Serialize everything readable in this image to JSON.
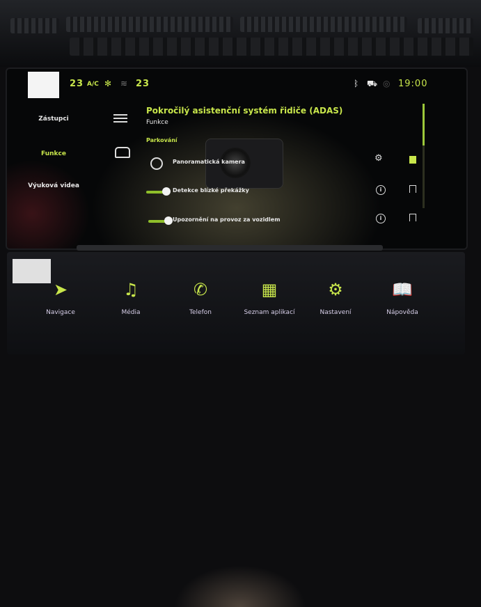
{
  "status_bar": {
    "temp_left": "23",
    "ac_label": "A/C",
    "temp_right": "23",
    "time": "19:00",
    "icons": [
      "fan-icon",
      "seat-heat-icon",
      "bluetooth-icon",
      "car-connect-icon",
      "signal-icon"
    ]
  },
  "sidebar": {
    "items": [
      {
        "label": "Zástupci",
        "active": false
      },
      {
        "label": "Funkce",
        "active": true
      },
      {
        "label": "Výuková videa",
        "active": false
      }
    ]
  },
  "main": {
    "title": "Pokročilý asistenční systém řidiče (ADAS)",
    "subtitle": "Funkce",
    "section": "Parkování",
    "rows": [
      {
        "label": "Panoramatická kamera",
        "type": "icon",
        "icon": "camera-360-icon",
        "action": "gear-icon",
        "bookmarked": true
      },
      {
        "label": "Detekce blízké překážky",
        "type": "toggle",
        "on": true,
        "action": "info-icon",
        "bookmarked": false
      },
      {
        "label": "Upozornění na provoz za vozidlem",
        "type": "toggle",
        "on": true,
        "action": "info-icon",
        "bookmarked": false
      }
    ]
  },
  "bottom_bar": {
    "buttons": [
      {
        "label": "Navigace",
        "icon": "navigation-icon"
      },
      {
        "label": "Média",
        "icon": "music-icon"
      },
      {
        "label": "Telefon",
        "icon": "phone-icon"
      },
      {
        "label": "Seznam aplikací",
        "icon": "apps-grid-icon"
      },
      {
        "label": "Nastavení",
        "icon": "gear-icon"
      },
      {
        "label": "Nápověda",
        "icon": "book-icon"
      }
    ]
  },
  "colors": {
    "accent": "#c8e64b",
    "text": "#e8e8e8",
    "background": "#060708"
  }
}
